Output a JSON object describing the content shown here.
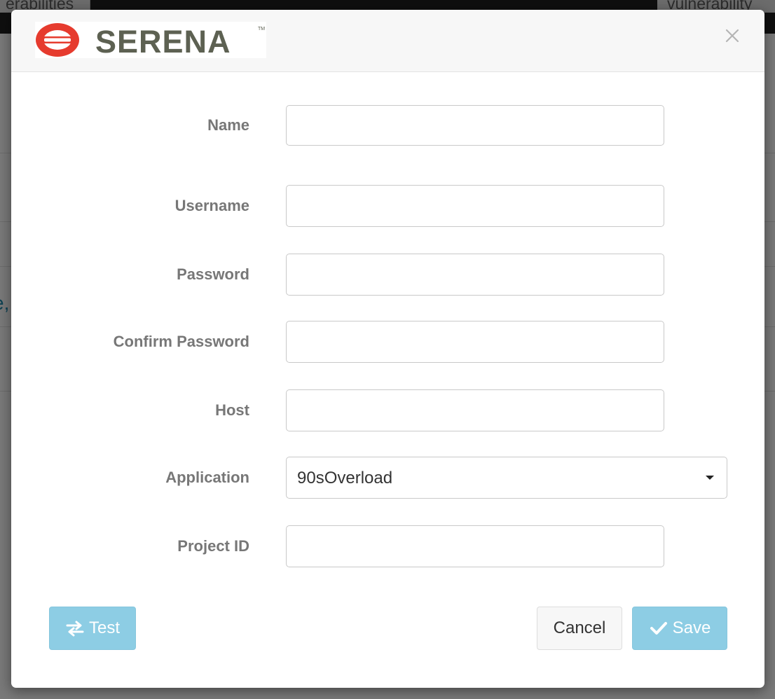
{
  "background": {
    "tab_left": "erabilities",
    "tab_right": "vulnerability",
    "edge_text": "e,"
  },
  "dialog": {
    "logo_text": "SERENA",
    "logo_tm": "TM",
    "logo_colors": {
      "ring": "#e63b2e",
      "wordmark": "#5d6152"
    },
    "fields": {
      "name": {
        "label": "Name",
        "value": "",
        "placeholder": ""
      },
      "username": {
        "label": "Username",
        "value": "",
        "placeholder": ""
      },
      "password": {
        "label": "Password",
        "value": "",
        "placeholder": ""
      },
      "confirm_password": {
        "label": "Confirm Password",
        "value": "",
        "placeholder": ""
      },
      "host": {
        "label": "Host",
        "value": "",
        "placeholder": ""
      },
      "application": {
        "label": "Application",
        "selected": "90sOverload"
      },
      "project_id": {
        "label": "Project ID",
        "value": "",
        "placeholder": ""
      }
    },
    "buttons": {
      "test": "Test",
      "cancel": "Cancel",
      "save": "Save"
    },
    "icons": {
      "close": "close-icon",
      "test": "exchange-arrows-icon",
      "save": "checkmark-icon",
      "select": "caret-down-icon"
    },
    "colors": {
      "primary_button": "#8dcde4",
      "label": "#777777"
    }
  }
}
